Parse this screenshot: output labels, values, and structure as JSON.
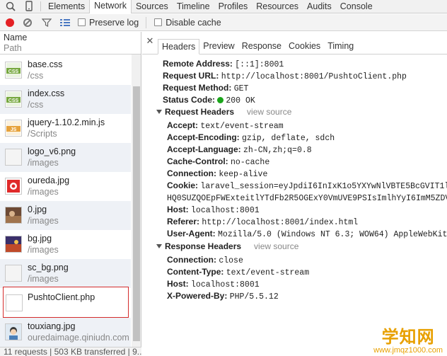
{
  "tabs": [
    "Elements",
    "Network",
    "Sources",
    "Timeline",
    "Profiles",
    "Resources",
    "Audits",
    "Console"
  ],
  "active_tab": "Network",
  "toolbar": {
    "preserve_log": "Preserve log",
    "disable_cache": "Disable cache"
  },
  "columns": {
    "name": "Name",
    "path": "Path"
  },
  "requests": [
    {
      "name": "base.css",
      "path": "/css",
      "icon": "css-file-icon"
    },
    {
      "name": "index.css",
      "path": "/css",
      "icon": "css-file-icon"
    },
    {
      "name": "jquery-1.10.2.min.js",
      "path": "/Scripts",
      "icon": "js-file-icon"
    },
    {
      "name": "logo_v6.png",
      "path": "/images",
      "icon": "image-file-icon"
    },
    {
      "name": "oureda.jpg",
      "path": "/images",
      "icon": "image-file-icon"
    },
    {
      "name": "0.jpg",
      "path": "/images",
      "icon": "image-file-icon"
    },
    {
      "name": "bg.jpg",
      "path": "/images",
      "icon": "image-file-icon"
    },
    {
      "name": "sc_bg.png",
      "path": "/images",
      "icon": "image-file-icon"
    },
    {
      "name": "PushtoClient.php",
      "path": "",
      "icon": "document-file-icon"
    },
    {
      "name": "touxiang.jpg",
      "path": "ouredaimage.qiniudn.com",
      "icon": "image-file-icon"
    }
  ],
  "status_bar": "11 requests | 503 KB transferred | 9...",
  "detail_tabs": [
    "Headers",
    "Preview",
    "Response",
    "Cookies",
    "Timing"
  ],
  "active_detail_tab": "Headers",
  "general": {
    "remote_address_key": "Remote Address:",
    "remote_address": "[::1]:8001",
    "request_url_key": "Request URL:",
    "request_url": "http://localhost:8001/PushtoClient.php",
    "request_method_key": "Request Method:",
    "request_method": "GET",
    "status_code_key": "Status Code:",
    "status_code": "200 OK"
  },
  "request_headers": {
    "title": "Request Headers",
    "view_source": "view source",
    "items": [
      {
        "k": "Accept:",
        "v": "text/event-stream"
      },
      {
        "k": "Accept-Encoding:",
        "v": "gzip, deflate, sdch"
      },
      {
        "k": "Accept-Language:",
        "v": "zh-CN,zh;q=0.8"
      },
      {
        "k": "Cache-Control:",
        "v": "no-cache"
      },
      {
        "k": "Connection:",
        "v": "keep-alive"
      },
      {
        "k": "Cookie:",
        "v": "laravel_session=eyJpdiI6InIxK1o5YXYwNlVBTE5BcGVIT1lUrQ"
      },
      {
        "k": "",
        "v": "HQ0SUZQOEpFWExteitlYTdFb2R5OGExY0VmUVE9PSIsImlhYyI6ImM5ZDVmN"
      },
      {
        "k": "Host:",
        "v": "localhost:8001"
      },
      {
        "k": "Referer:",
        "v": "http://localhost:8001/index.html"
      },
      {
        "k": "User-Agent:",
        "v": "Mozilla/5.0 (Windows NT 6.3; WOW64) AppleWebKit/5"
      }
    ]
  },
  "response_headers": {
    "title": "Response Headers",
    "view_source": "view source",
    "items": [
      {
        "k": "Connection:",
        "v": "close"
      },
      {
        "k": "Content-Type:",
        "v": "text/event-stream"
      },
      {
        "k": "Host:",
        "v": "localhost:8001"
      },
      {
        "k": "X-Powered-By:",
        "v": "PHP/5.5.12"
      }
    ]
  },
  "watermark": {
    "title": "学知网",
    "url": "www.jmqz1000.com"
  },
  "colors": {
    "record": "#e42125",
    "status_ok": "#1aa51a",
    "selected_border": "#d42c2c",
    "watermark": "#e8a000"
  }
}
